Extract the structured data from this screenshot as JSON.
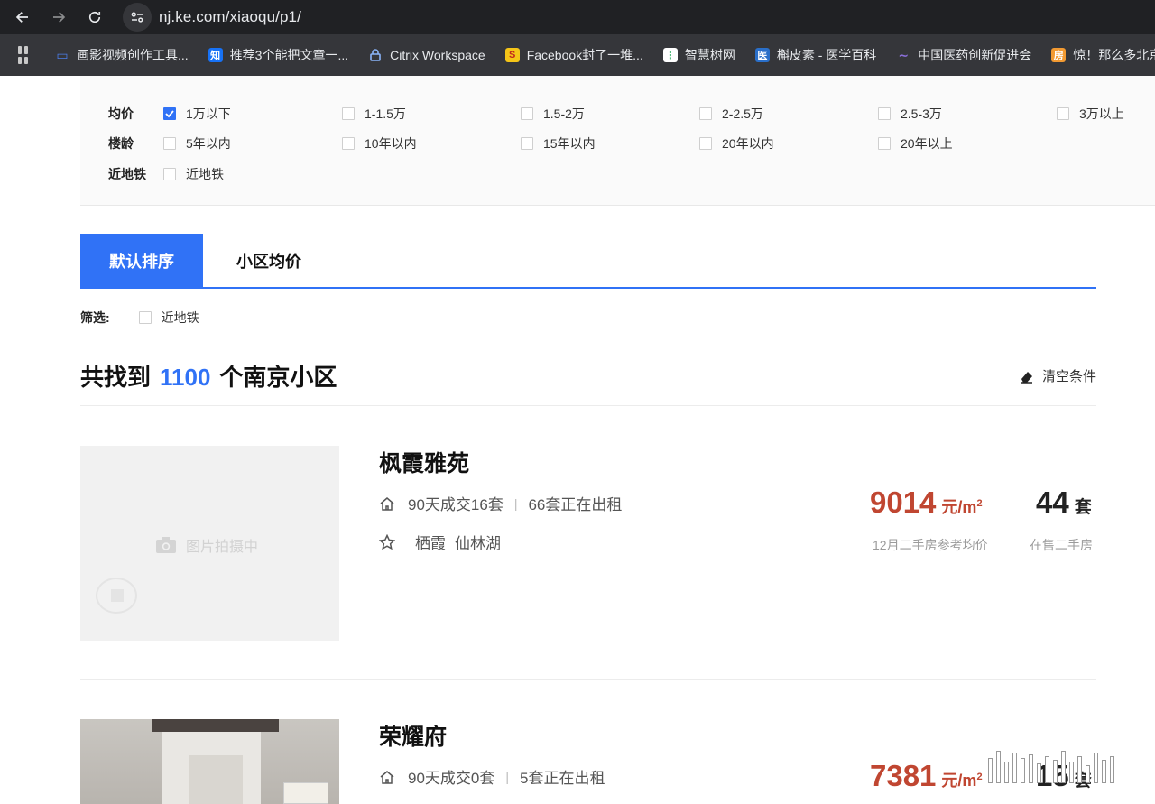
{
  "browser": {
    "url": "nj.ke.com/xiaoqu/p1/",
    "bookmarks": [
      {
        "label": "画影视频创作工具...",
        "icon": "video-tool-icon",
        "color": "#4c7de8"
      },
      {
        "label": "推荐3个能把文章一...",
        "icon": "zhihu-icon",
        "color": "#1772f6"
      },
      {
        "label": "Citrix Workspace",
        "icon": "citrix-icon",
        "color": "#4a90d9"
      },
      {
        "label": "Facebook封了一堆...",
        "icon": "s-logo-icon",
        "color": "#f5c518"
      },
      {
        "label": "智慧树网",
        "icon": "zhihuishu-icon",
        "color": "#ffffff"
      },
      {
        "label": "槲皮素 - 医学百科",
        "icon": "medical-icon",
        "color": "#2a6fc9"
      },
      {
        "label": "中国医药创新促进会",
        "icon": "pharma-icon",
        "color": "#5a3fa0"
      },
      {
        "label": "惊！那么多北京人",
        "icon": "house-icon",
        "color": "#f29a32"
      }
    ]
  },
  "filters": {
    "price": {
      "label": "均价",
      "options": [
        {
          "text": "1万以下",
          "checked": true
        },
        {
          "text": "1-1.5万",
          "checked": false
        },
        {
          "text": "1.5-2万",
          "checked": false
        },
        {
          "text": "2-2.5万",
          "checked": false
        },
        {
          "text": "2.5-3万",
          "checked": false
        },
        {
          "text": "3万以上",
          "checked": false
        }
      ]
    },
    "age": {
      "label": "楼龄",
      "options": [
        {
          "text": "5年以内",
          "checked": false
        },
        {
          "text": "10年以内",
          "checked": false
        },
        {
          "text": "15年以内",
          "checked": false
        },
        {
          "text": "20年以内",
          "checked": false
        },
        {
          "text": "20年以上",
          "checked": false
        }
      ]
    },
    "subway": {
      "label": "近地铁",
      "options": [
        {
          "text": "近地铁",
          "checked": false
        }
      ]
    }
  },
  "tabs": {
    "default_sort": "默认排序",
    "avg_price": "小区均价"
  },
  "screen": {
    "label": "筛选:",
    "option": "近地铁"
  },
  "result": {
    "prefix": "共找到",
    "count": "1100",
    "suffix": "个南京小区",
    "clear": "清空条件"
  },
  "listings": [
    {
      "name": "枫霞雅苑",
      "deals": "90天成交16套",
      "rent": "66套正在出租",
      "district": "栖霞",
      "area": "仙林湖",
      "image_placeholder": "图片拍摄中",
      "price": "9014",
      "price_unit": "元/m",
      "price_label": "12月二手房参考均价",
      "on_sale": "44",
      "on_sale_unit": "套",
      "on_sale_label": "在售二手房"
    },
    {
      "name": "荣耀府",
      "deals": "90天成交0套",
      "rent": "5套正在出租",
      "price": "7381",
      "price_unit": "元/m",
      "on_sale": "15",
      "on_sale_unit": "套"
    }
  ]
}
